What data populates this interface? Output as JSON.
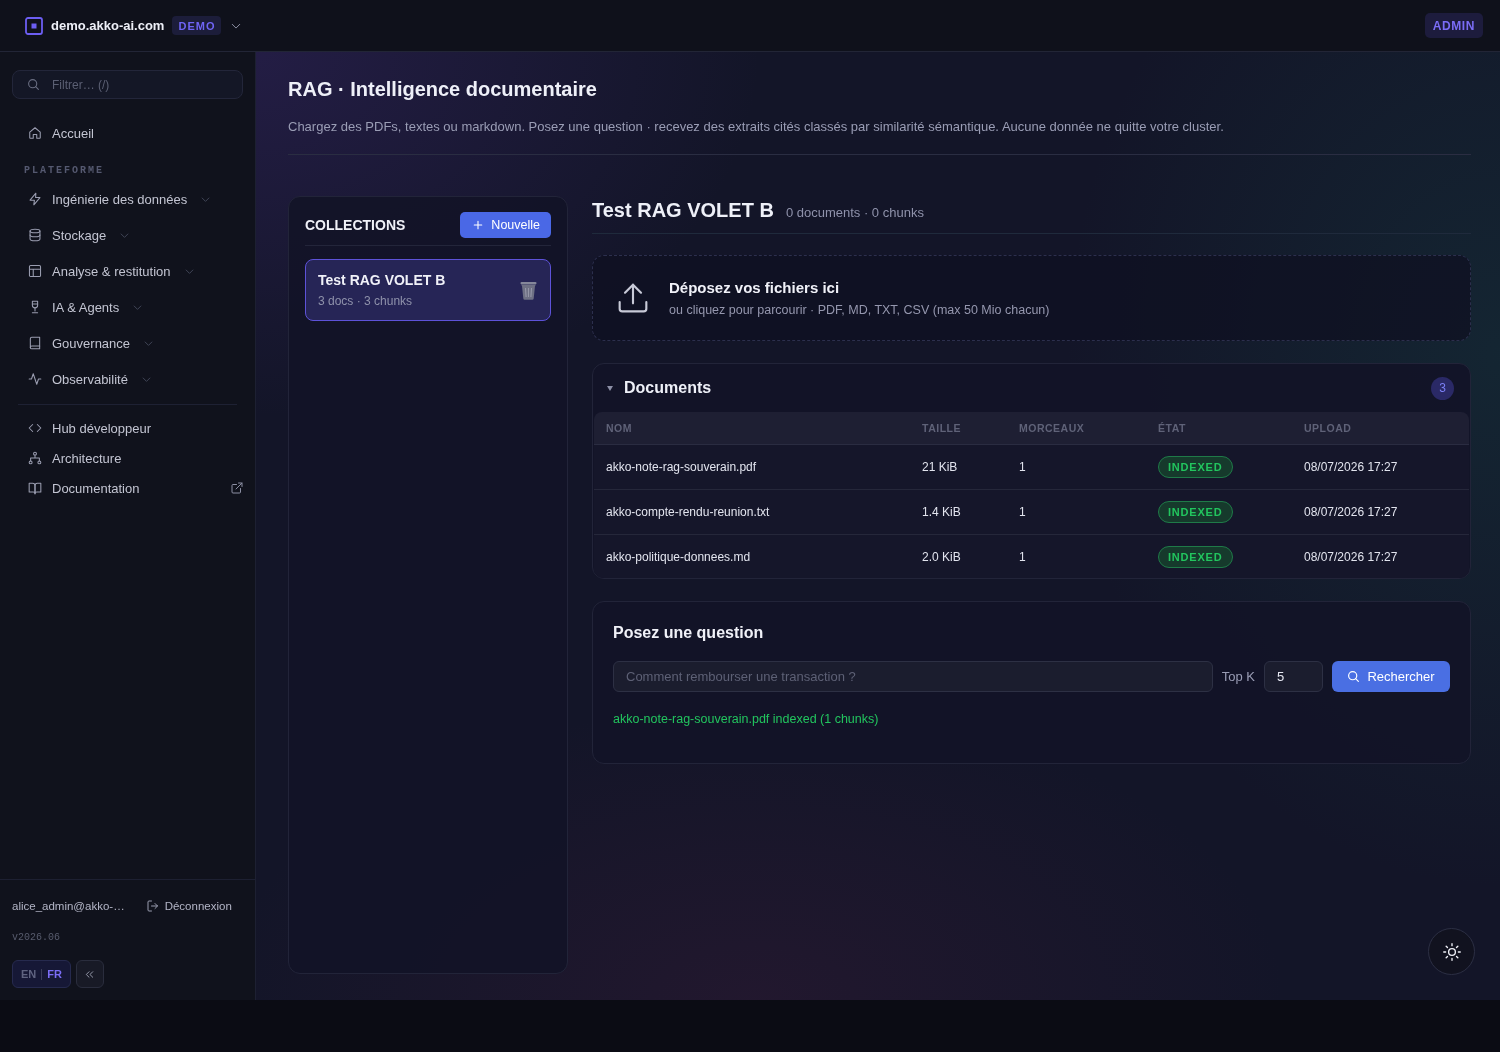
{
  "topbar": {
    "domain": "demo.akko-ai.com",
    "environment": "DEMO",
    "role": "ADMIN"
  },
  "sidebar": {
    "search": {
      "placeholder": "Filtrer… (/)"
    },
    "primary": [
      {
        "label": "Accueil",
        "kind": "link"
      }
    ],
    "section_title": "PLATEFORME",
    "platform": [
      {
        "label": "Ingénierie des données",
        "kind": "group"
      },
      {
        "label": "Stockage",
        "kind": "group"
      },
      {
        "label": "Analyse & restitution",
        "kind": "group"
      },
      {
        "label": "IA & Agents",
        "kind": "group"
      },
      {
        "label": "Gouvernance",
        "kind": "group"
      },
      {
        "label": "Observabilité",
        "kind": "group"
      }
    ],
    "secondary": [
      {
        "label": "Hub développeur",
        "kind": "link"
      },
      {
        "label": "Architecture",
        "kind": "link"
      },
      {
        "label": "Documentation",
        "kind": "external"
      }
    ],
    "user": {
      "email": "alice_admin@akko-…",
      "logout": "Déconnexion"
    },
    "version": "v2026.06",
    "languages": [
      {
        "label": "EN",
        "selected": false
      },
      {
        "label": "FR",
        "selected": true
      }
    ]
  },
  "page": {
    "title": "RAG · Intelligence documentaire",
    "description": "Chargez des PDFs, textes ou markdown. Posez une question · recevez des extraits cités classés par similarité sémantique. Aucune donnée ne quitte votre cluster."
  },
  "collections": {
    "title": "COLLECTIONS",
    "new_button": "Nouvelle",
    "items": [
      {
        "name": "Test RAG VOLET B",
        "meta": "3 docs · 3 chunks",
        "selected": true
      }
    ]
  },
  "collection_detail": {
    "title": "Test RAG VOLET B",
    "meta": "0 documents · 0 chunks",
    "dropzone": {
      "title": "Déposez vos fichiers ici",
      "hint": "ou cliquez pour parcourir · PDF, MD, TXT, CSV (max 50 Mio chacun)"
    },
    "documents": {
      "title": "Documents",
      "expanded": true,
      "count": "3",
      "columns": [
        "NOM",
        "TAILLE",
        "MORCEAUX",
        "ÉTAT",
        "UPLOAD"
      ],
      "rows": [
        {
          "name": "akko-note-rag-souverain.pdf",
          "size": "21 KiB",
          "chunks": "1",
          "status": {
            "label": "INDEXED",
            "kind": "success"
          },
          "uploaded": "08/07/2026 17:27"
        },
        {
          "name": "akko-compte-rendu-reunion.txt",
          "size": "1.4 KiB",
          "chunks": "1",
          "status": {
            "label": "INDEXED",
            "kind": "success"
          },
          "uploaded": "08/07/2026 17:27"
        },
        {
          "name": "akko-politique-donnees.md",
          "size": "2.0 KiB",
          "chunks": "1",
          "status": {
            "label": "INDEXED",
            "kind": "success"
          },
          "uploaded": "08/07/2026 17:27"
        }
      ]
    },
    "question": {
      "title": "Posez une question",
      "query": {
        "placeholder": "Comment rembourser une transaction ?"
      },
      "top_k": {
        "label": "Top K",
        "value": "5"
      },
      "search_button": "Rechercher",
      "message": {
        "text": "akko-note-rag-souverain.pdf indexed (1 chunks)",
        "kind": "success"
      }
    }
  }
}
